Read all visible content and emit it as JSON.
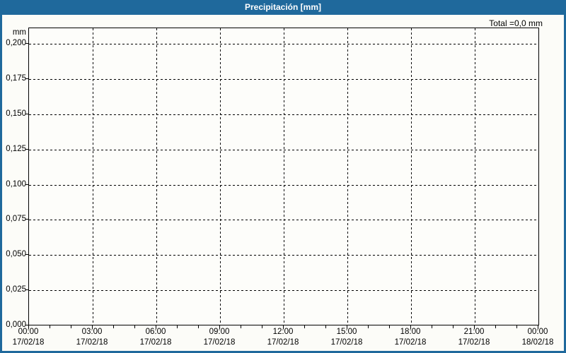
{
  "header": {
    "title": "Precipitación [mm]"
  },
  "summary": {
    "total_label": "Total =0,0 mm"
  },
  "colors": {
    "accent_blue": "#1f699c",
    "background": "#fcfcf8",
    "grid": "#000000"
  },
  "chart_data": {
    "type": "line",
    "title": "Precipitación [mm]",
    "xlabel": "",
    "ylabel": "mm",
    "ylim": [
      0,
      0.2105
    ],
    "x_range_hours": [
      0,
      24
    ],
    "grid": "dashed",
    "legend_position": "none",
    "y_ticks": {
      "labels": [
        "0,200",
        "0,175",
        "0,150",
        "0,125",
        "0,100",
        "0,075",
        "0,050",
        "0,025",
        "0,000"
      ],
      "values": [
        0.2,
        0.175,
        0.15,
        0.125,
        0.1,
        0.075,
        0.05,
        0.025,
        0.0
      ]
    },
    "x_ticks": {
      "hours": [
        0,
        3,
        6,
        9,
        12,
        15,
        18,
        21,
        24
      ],
      "times": [
        "00:00",
        "03:00",
        "06:00",
        "09:00",
        "12:00",
        "15:00",
        "18:00",
        "21:00",
        "00:00"
      ],
      "dates": [
        "17/02/18",
        "17/02/18",
        "17/02/18",
        "17/02/18",
        "17/02/18",
        "17/02/18",
        "17/02/18",
        "17/02/18",
        "18/02/18"
      ],
      "minor_step_hours": 1
    },
    "series": [
      {
        "name": "Precipitación",
        "values": []
      }
    ],
    "total_text": "Total =0,0 mm",
    "total_mm": 0.0
  }
}
